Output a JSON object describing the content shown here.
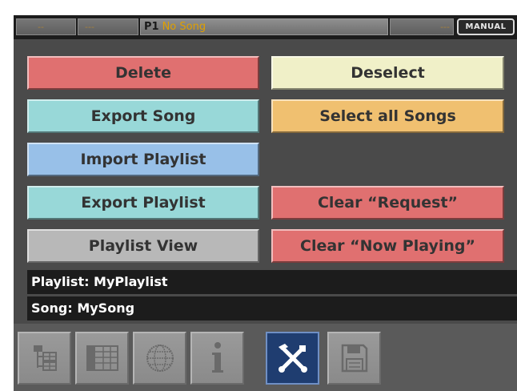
{
  "status_bar": {
    "seg1": "--",
    "seg2": "---",
    "player": "P1",
    "song": "No Song",
    "seg_right": "---",
    "mode": "MANUAL"
  },
  "buttons": {
    "delete": "Delete",
    "deselect": "Deselect",
    "export_song": "Export Song",
    "select_all": "Select all Songs",
    "import_playlist": "Import Playlist",
    "export_playlist": "Export Playlist",
    "clear_request": "Clear “Request”",
    "playlist_view": "Playlist View",
    "clear_now_playing": "Clear “Now Playing”"
  },
  "info": {
    "playlist": "Playlist: MyPlaylist",
    "song": "Song: MySong"
  },
  "tabs": [
    {
      "icon": "folder-tree-icon"
    },
    {
      "icon": "grid-list-icon"
    },
    {
      "icon": "globe-icon"
    },
    {
      "icon": "info-icon"
    },
    {
      "icon": "tools-icon",
      "active": true
    },
    {
      "icon": "floppy-disk-icon"
    }
  ],
  "colors": {
    "red": "#e07070",
    "cream": "#f0f0c8",
    "cyan": "#98d8d8",
    "orange": "#f0c070",
    "blue": "#98c0e8",
    "gray": "#b8b8b8",
    "active_tab": "#1f3d70"
  }
}
